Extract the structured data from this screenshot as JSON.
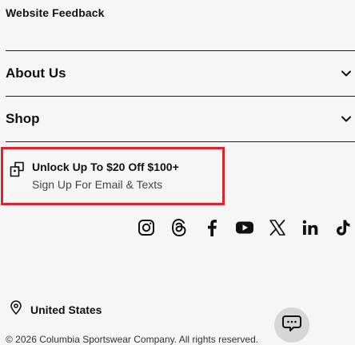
{
  "footer": {
    "website_feedback": "Website Feedback",
    "accordion": [
      {
        "label": "About Us",
        "icon": "chevron-down-icon"
      },
      {
        "label": "Shop",
        "icon": "chevron-down-icon"
      }
    ],
    "promo": {
      "icon": "tag-icon",
      "title": "Unlock Up To $20 Off $100+",
      "subtitle": "Sign Up For Email & Texts",
      "highlight_color": "#e0222a"
    },
    "social_icons": [
      "instagram-icon",
      "threads-icon",
      "facebook-icon",
      "youtube-icon",
      "x-icon",
      "linkedin-icon",
      "tiktok-icon"
    ],
    "location": {
      "icon": "location-pin-icon",
      "label": "United States"
    },
    "chat": {
      "icon": "chat-icon"
    },
    "copyright": "© 2026 Columbia Sportswear Company. All rights reserved."
  }
}
